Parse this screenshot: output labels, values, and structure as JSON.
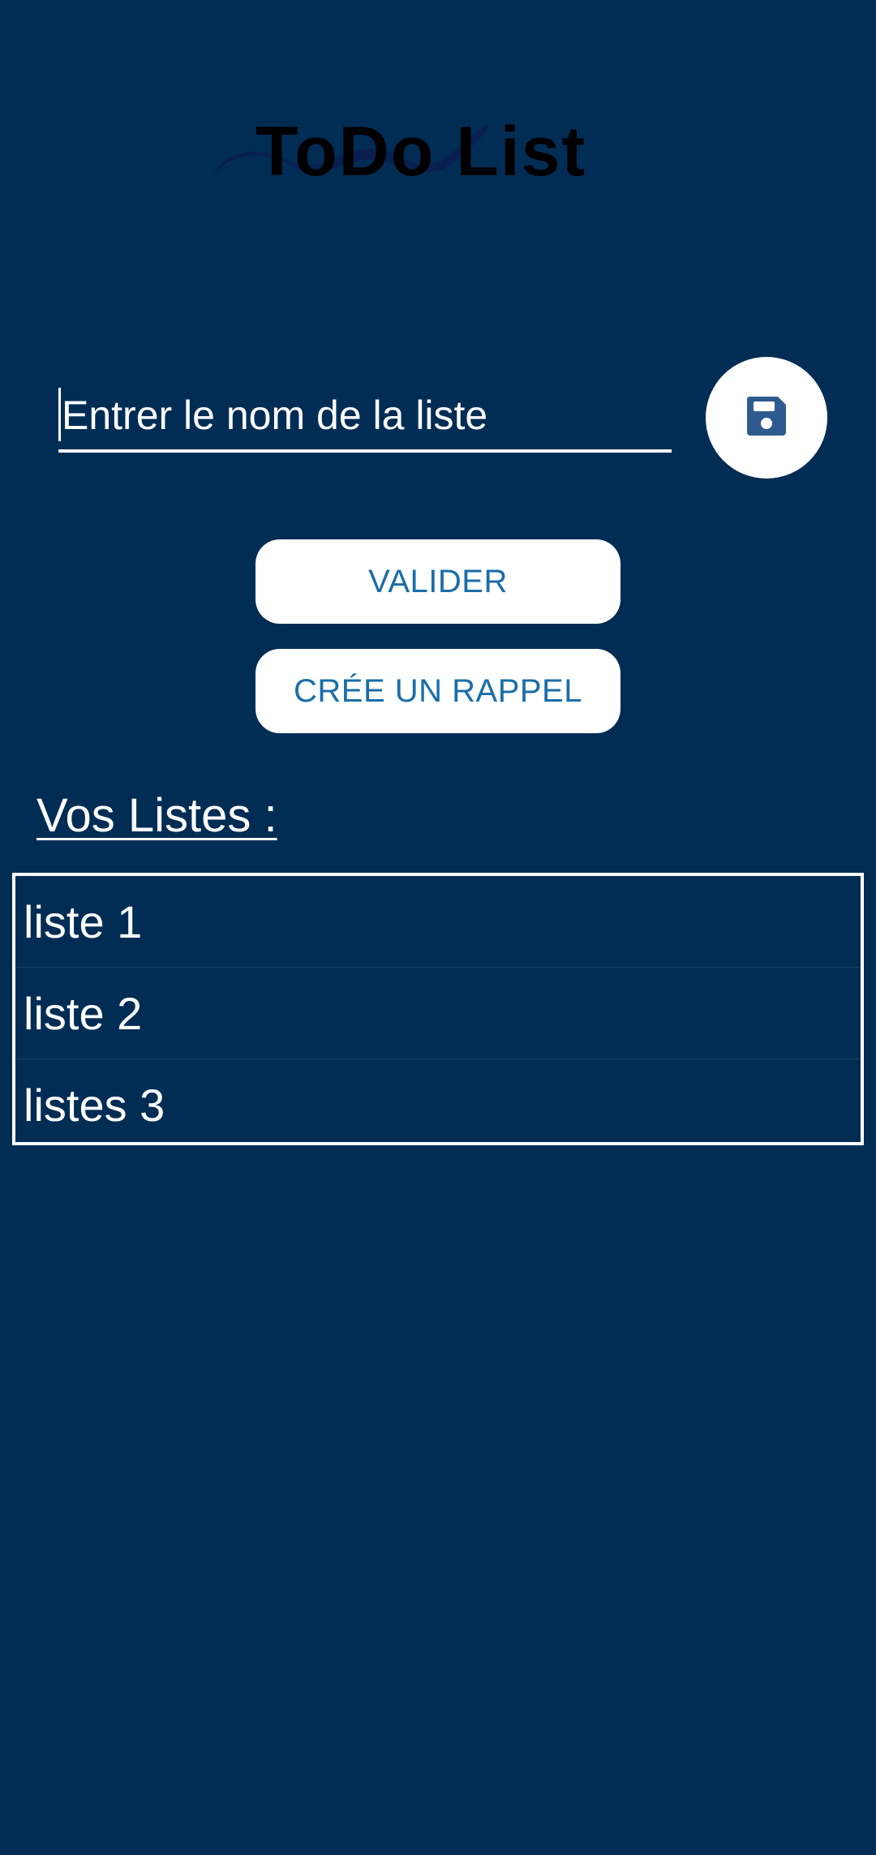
{
  "header": {
    "logo_text": "ToDo List"
  },
  "name_input": {
    "placeholder": "Entrer le nom de la liste",
    "value": ""
  },
  "save_button": {
    "icon": "save-icon"
  },
  "buttons": {
    "validate_label": "VALIDER",
    "reminder_label": "CRÉE UN RAPPEL"
  },
  "lists_section": {
    "title": "Vos Listes :",
    "items": [
      {
        "label": "liste 1"
      },
      {
        "label": "liste 2"
      },
      {
        "label": "listes 3"
      }
    ]
  },
  "colors": {
    "background": "#012d55",
    "button_text": "#1a6ea8",
    "save_icon": "#2f5a8f",
    "white": "#ffffff"
  }
}
